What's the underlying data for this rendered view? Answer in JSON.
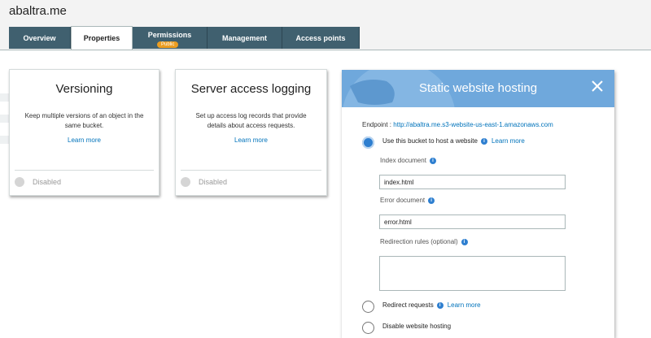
{
  "bucket": {
    "name": "abaltra.me"
  },
  "tabs": [
    {
      "label": "Overview",
      "active": false
    },
    {
      "label": "Properties",
      "active": true
    },
    {
      "label": "Permissions",
      "active": false,
      "badge": "Public"
    },
    {
      "label": "Management",
      "active": false
    },
    {
      "label": "Access points",
      "active": false
    }
  ],
  "cards": {
    "versioning": {
      "title": "Versioning",
      "description": "Keep multiple versions of an object in the same bucket.",
      "learn_more": "Learn more",
      "status": "Disabled"
    },
    "logging": {
      "title": "Server access logging",
      "description": "Set up access log records that provide details about access requests.",
      "learn_more": "Learn more",
      "status": "Disabled"
    }
  },
  "hosting": {
    "title": "Static website hosting",
    "endpoint_label": "Endpoint :",
    "endpoint_url": "http://abaltra.me.s3-website-us-east-1.amazonaws.com",
    "option_use": "Use this bucket to host a website",
    "option_use_learn": "Learn more",
    "index_label": "Index document",
    "index_value": "index.html",
    "error_label": "Error document",
    "error_value": "error.html",
    "redirection_label": "Redirection rules (optional)",
    "option_redirect": "Redirect requests",
    "option_redirect_learn": "Learn more",
    "option_disable": "Disable website hosting",
    "selected_option": "use"
  },
  "colors": {
    "tab_bg": "#40606f",
    "panel_header": "#6fa8dc",
    "link": "#0073bb",
    "badge": "#ec9d21"
  }
}
